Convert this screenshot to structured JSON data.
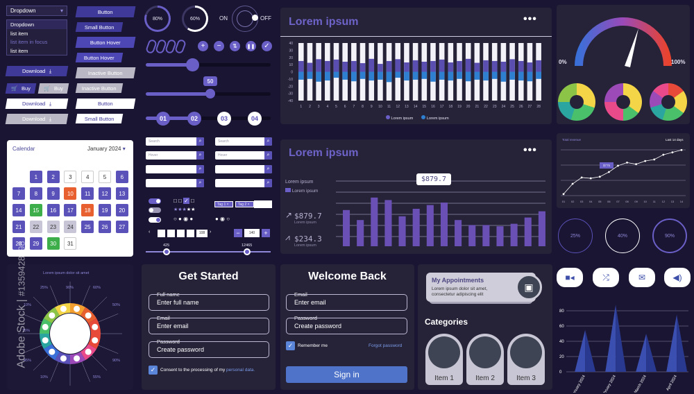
{
  "dropdown": {
    "label": "Dropdown",
    "items": [
      "Dropdown",
      "list item",
      "list item in focus",
      "list item"
    ]
  },
  "buttons": {
    "button": "Button",
    "small_button": "Small Button",
    "button_hover": "Button Hover",
    "inactive_button": "Inactive Button",
    "download": "Download",
    "buy": "Buy"
  },
  "progress_rings": [
    {
      "label": "80%",
      "value": 80
    },
    {
      "label": "60%",
      "value": 60
    }
  ],
  "toggle": {
    "on": "ON",
    "off": "OFF"
  },
  "slider_value": "50",
  "steps": [
    "01",
    "02",
    "03",
    "04"
  ],
  "search": {
    "placeholder": "Search",
    "hover": "Hover"
  },
  "tags": [
    "Tag 1",
    "Tag 2"
  ],
  "pager": {
    "last": "108",
    "stepper": "140"
  },
  "range": {
    "min": "425",
    "max": "12465"
  },
  "stacked_chart": {
    "title": "Lorem ipsum",
    "legend": [
      "Lorem ipsum",
      "Lorem ipsum"
    ],
    "yticks": [
      "40",
      "30",
      "20",
      "10",
      "0",
      "-10",
      "-20",
      "-30",
      "-40"
    ],
    "categories": [
      "1",
      "2",
      "3",
      "4",
      "5",
      "6",
      "7",
      "8",
      "9",
      "10",
      "11",
      "12",
      "13",
      "14",
      "15",
      "16",
      "17",
      "18",
      "19",
      "20",
      "21",
      "22",
      "23",
      "24",
      "25",
      "26",
      "27",
      "28"
    ]
  },
  "bar_chart": {
    "title": "Lorem ipsum",
    "tooltip": "$879.7",
    "side_title": "Lorem ipsum",
    "side_legend": "Lorem ipsum",
    "stat1_value": "$879.7",
    "stat1_label": "Lorem ipsum",
    "stat2_value": "$234.3",
    "stat2_label": "Lorem ipsum"
  },
  "chart_data": [
    {
      "type": "bar",
      "title": "Lorem ipsum",
      "categories": [
        "1",
        "2",
        "3",
        "4",
        "5",
        "6",
        "7",
        "8",
        "9",
        "10",
        "11",
        "12",
        "13",
        "14",
        "15",
        "16",
        "17",
        "18",
        "19",
        "20",
        "21",
        "22",
        "23",
        "24",
        "25",
        "26",
        "27",
        "28"
      ],
      "ylim": [
        -40,
        40
      ],
      "series": [
        {
          "name": "Lorem ipsum",
          "values": [
            30,
            25,
            35,
            30,
            34,
            28,
            30,
            24,
            36,
            22,
            30,
            35,
            26,
            32,
            28,
            30,
            34,
            26,
            30,
            36,
            25,
            32,
            30,
            28,
            35,
            30,
            26,
            32
          ]
        },
        {
          "name": "Lorem ipsum",
          "values": [
            -20,
            -18,
            -25,
            -22,
            -15,
            -20,
            -24,
            -18,
            -22,
            -20,
            -26,
            -15,
            -22,
            -20,
            -18,
            -25,
            -20,
            -22,
            -18,
            -24,
            -20,
            -22,
            -18,
            -25,
            -20,
            -22,
            -24,
            -18
          ]
        }
      ]
    },
    {
      "type": "bar",
      "title": "Lorem ipsum",
      "values": [
        58,
        42,
        78,
        74,
        48,
        60,
        66,
        70,
        42,
        34,
        34,
        32,
        36,
        46,
        56
      ]
    },
    {
      "type": "line",
      "title": "Total revenue",
      "legend": "Last 14 days",
      "x": [
        "01",
        "02",
        "03",
        "04",
        "05",
        "06",
        "07",
        "08",
        "09",
        "10",
        "11",
        "12",
        "13",
        "14"
      ],
      "values": [
        2,
        15,
        23,
        22,
        24,
        30,
        38,
        42,
        40,
        44,
        46,
        52,
        55,
        58
      ]
    },
    {
      "type": "bar",
      "categories": [
        "January 2024",
        "February 2024",
        "March 2024",
        "April 2024"
      ],
      "yticks": [
        "80",
        "60",
        "40",
        "20",
        "0"
      ],
      "values": [
        55,
        88,
        50,
        75
      ]
    }
  ],
  "gauge": {
    "min": "0%",
    "max": "100%"
  },
  "line_chart": {
    "title": "Total revenue",
    "legend": "Last 14 days",
    "tooltip": "$775"
  },
  "circle_progress": [
    "25%",
    "40%",
    "90%"
  ],
  "calendar": {
    "title": "Calendar",
    "month": "January 2024",
    "days": [
      "1",
      "2",
      "3",
      "4",
      "5",
      "6",
      "7",
      "8",
      "9",
      "10",
      "11",
      "12",
      "13",
      "14",
      "15",
      "16",
      "17",
      "18",
      "19",
      "20",
      "21",
      "22",
      "23",
      "24",
      "25",
      "26",
      "27",
      "28",
      "29",
      "30",
      "31"
    ]
  },
  "infographic": {
    "title": "Lorem ipsum dolor sit amet",
    "left_pcts": [
      "25%",
      "10%",
      "75%",
      "45%",
      "10%"
    ],
    "top_pcts": [
      "90%",
      "60%"
    ],
    "right_pcts": [
      "50%",
      "90%",
      "55%"
    ]
  },
  "get_started": {
    "title": "Get Started",
    "full_name_label": "Full name",
    "full_name_placeholder": "Enter full name",
    "email_label": "Email",
    "email_placeholder": "Enter email",
    "password_label": "Password",
    "password_placeholder": "Create password",
    "consent_text": "Consent to the processing of my",
    "consent_link": "personal data."
  },
  "welcome_back": {
    "title": "Welcome Back",
    "email_label": "Email",
    "email_placeholder": "Enter email",
    "password_label": "Password",
    "password_placeholder": "Create password",
    "remember": "Remember me",
    "forgot": "Forgot password",
    "signin": "Sign in"
  },
  "appointments": {
    "title": "My Appointments",
    "text": "Lorem ipsum dolor sit amet, consectetur adipiscing elit",
    "categories_title": "Categories",
    "items": [
      "Item 1",
      "Item 2",
      "Item 3"
    ]
  },
  "watermark": {
    "brand": "Adobe Stock",
    "id": "#1359428098"
  }
}
